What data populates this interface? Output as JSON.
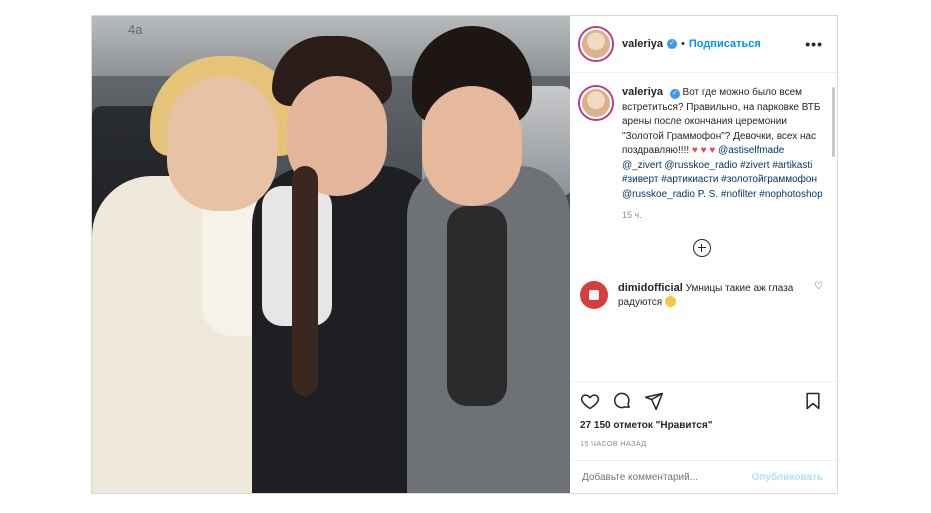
{
  "post": {
    "photo": {
      "sign_text": "4а"
    },
    "header": {
      "username": "valeriya",
      "verified_icon": "verified-badge-icon",
      "dot": "•",
      "follow_label": "Подписаться",
      "more_icon": "more-options-icon",
      "more_label": "•••"
    },
    "caption": {
      "username": "valeriya",
      "text": "Вот где можно было всем встретиться? Правильно, на парковке ВТБ арены после окончания церемонии \"Золотой Граммофон\"? Девочки, всех нас поздравляю!!!!",
      "hearts": "♥ ♥ ♥",
      "tags": "@astiselfmade @_zivert @russkoe_radio #zivert #artikasti #зиверт #артикиасти #золотойграммофон @russkoe_radio P. S. #nofilter #nophotoshop",
      "time": "15 ч."
    },
    "comments": [
      {
        "username": "dimidofficial",
        "text": "Умницы такие аж глаза радуются",
        "emoji_icon": "smiling-face-emoji-icon",
        "heart_label": "♡"
      }
    ],
    "actions": {
      "like_icon": "heart-icon",
      "comment_icon": "comment-icon",
      "share_icon": "paper-plane-icon",
      "save_icon": "bookmark-icon",
      "likes": "27 150 отметок \"Нравится\"",
      "posted": "15 часов назад"
    },
    "add_comment": {
      "placeholder": "Добавьте комментарий...",
      "publish_label": "Опубликовать"
    },
    "colors": {
      "link": "#0095f6",
      "tag": "#00376b",
      "heart": "#ed4956",
      "muted": "#8e8e8e",
      "publish_disabled": "#b2dffc"
    }
  }
}
